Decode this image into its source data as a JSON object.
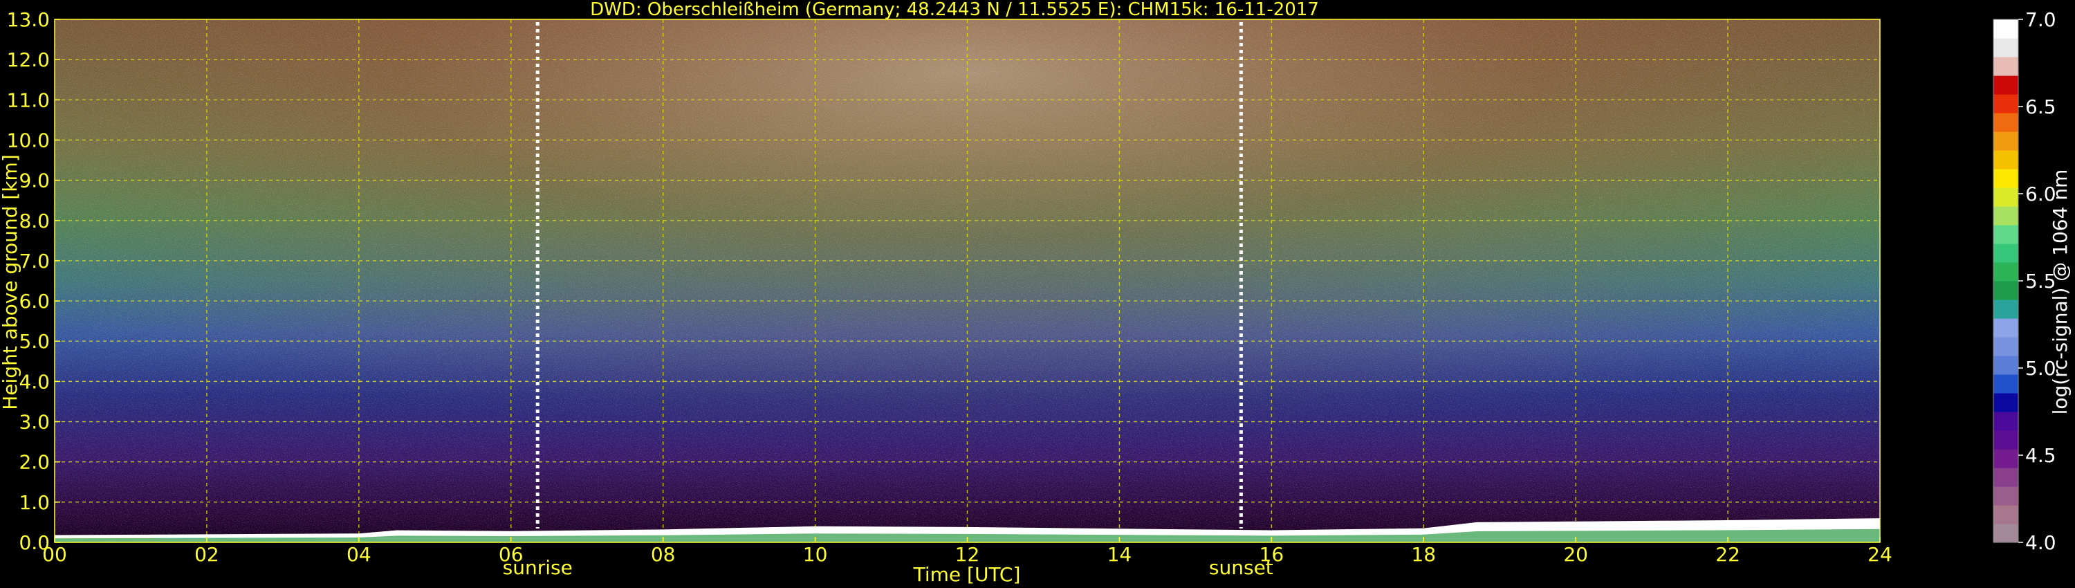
{
  "chart_data": {
    "type": "heatmap",
    "title": "DWD: Oberschleißheim (Germany; 48.2443 N / 11.5525 E):    CHM15k: 16-11-2017",
    "xlabel": "Time [UTC]",
    "ylabel": "Height above ground [km]",
    "xlim": [
      0,
      24
    ],
    "ylim": [
      0,
      13
    ],
    "x_ticks": [
      0,
      2,
      4,
      6,
      8,
      10,
      12,
      14,
      16,
      18,
      20,
      22,
      24
    ],
    "x_tick_labels": [
      "00",
      "02",
      "04",
      "06",
      "08",
      "10",
      "12",
      "14",
      "16",
      "18",
      "20",
      "22",
      "24"
    ],
    "y_ticks": [
      0,
      1,
      2,
      3,
      4,
      5,
      6,
      7,
      8,
      9,
      10,
      11,
      12,
      13
    ],
    "y_tick_labels": [
      "0.0",
      "1.0",
      "2.0",
      "3.0",
      "4.0",
      "5.0",
      "6.0",
      "7.0",
      "8.0",
      "9.0",
      "10.0",
      "11.0",
      "12.0",
      "13.0"
    ],
    "grid": true,
    "annotations": [
      {
        "label": "sunrise",
        "x": 6.35
      },
      {
        "label": "sunset",
        "x": 15.6
      }
    ],
    "boundary_layer_top_km": [
      [
        0,
        0.18
      ],
      [
        2,
        0.2
      ],
      [
        4,
        0.22
      ],
      [
        4.5,
        0.3
      ],
      [
        6,
        0.28
      ],
      [
        8,
        0.32
      ],
      [
        10,
        0.4
      ],
      [
        12,
        0.38
      ],
      [
        14,
        0.34
      ],
      [
        16,
        0.3
      ],
      [
        18,
        0.35
      ],
      [
        18.7,
        0.5
      ],
      [
        20,
        0.52
      ],
      [
        22,
        0.55
      ],
      [
        24,
        0.6
      ]
    ],
    "colorbar": {
      "label": "log(rc-signal) @ 1064 nm",
      "range": [
        4.0,
        7.0
      ],
      "ticks": [
        4.0,
        4.5,
        5.0,
        5.5,
        6.0,
        6.5,
        7.0
      ],
      "tick_labels": [
        "4.0",
        "4.5",
        "5.0",
        "5.5",
        "6.0",
        "6.5",
        "7.0"
      ],
      "colors": [
        "#a48999",
        "#a8778e",
        "#9b5d8c",
        "#8a3f8c",
        "#731b8f",
        "#5d0e94",
        "#4b0a99",
        "#0a0aa0",
        "#2050cc",
        "#5a7ed8",
        "#7a93e0",
        "#8da4e8",
        "#2aa39a",
        "#1e9b4a",
        "#2bb356",
        "#37c77a",
        "#5fd98a",
        "#a8e060",
        "#d8ea2a",
        "#ffe800",
        "#f5c000",
        "#f29a10",
        "#f06a10",
        "#e8300c",
        "#cc0808",
        "#e6bcb4",
        "#e8e8e8",
        "#ffffff"
      ]
    }
  }
}
